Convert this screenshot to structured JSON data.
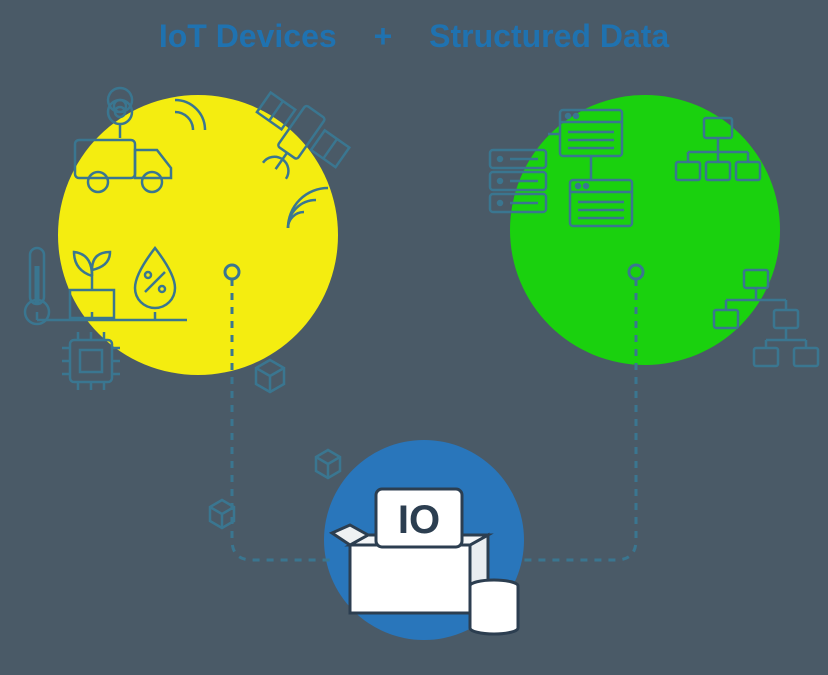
{
  "heading": {
    "left": "IoT Devices",
    "plus": "+",
    "right": "Structured Data"
  },
  "nodes": {
    "iot": {
      "color": "#f4ed10",
      "icons": [
        "truck-location",
        "satellite",
        "signal",
        "antenna",
        "thermometer",
        "plant",
        "humidity",
        "chip",
        "cube"
      ]
    },
    "structured": {
      "color": "#1ad10e",
      "icons": [
        "database-stack",
        "table-windows",
        "org-chart",
        "tree-nodes"
      ]
    },
    "hub": {
      "color": "#2976bb",
      "label": "IO",
      "icons": [
        "box",
        "database-coins"
      ]
    }
  },
  "connections": [
    {
      "from": "iot",
      "to": "hub",
      "style": "dashed",
      "color": "#3a7690"
    },
    {
      "from": "structured",
      "to": "hub",
      "style": "dashed",
      "color": "#3a7690"
    }
  ],
  "floating_icons": [
    "cube-small-left",
    "cube-small-center"
  ]
}
